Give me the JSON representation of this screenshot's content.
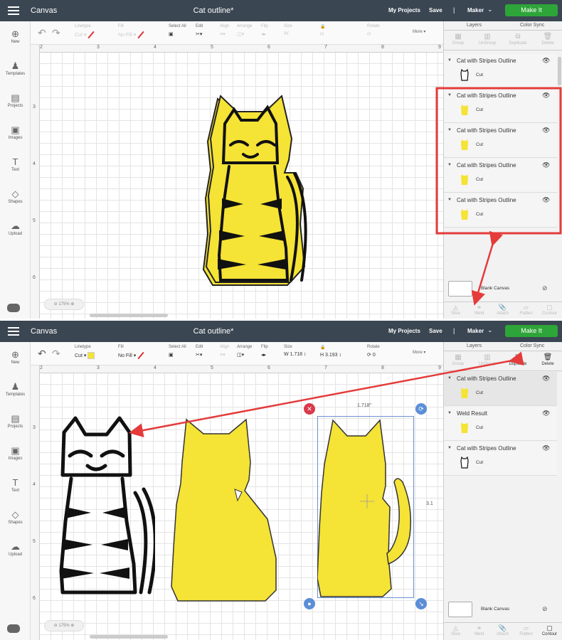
{
  "app": {
    "section": "Canvas",
    "project_title": "Cat outline*",
    "my_projects": "My Projects",
    "save": "Save",
    "separator": "|",
    "machine": "Maker",
    "make_it": "Make It"
  },
  "left_sidebar": [
    "New",
    "Templates",
    "Projects",
    "Images",
    "Text",
    "Shapes",
    "Upload"
  ],
  "toolbar": {
    "linetype_label": "Linetype",
    "linetype_value": "Cut",
    "fill_label": "Fill",
    "fill_value": "No Fill",
    "select_all": "Select All",
    "edit": "Edit",
    "align": "Align",
    "arrange": "Arrange",
    "flip": "Flip",
    "size": "Size",
    "size_w_label": "W",
    "size_h_label": "H",
    "size_w": "1.718",
    "size_h": "3.193",
    "rotate": "Rotate",
    "rotate_value": "0",
    "more": "More"
  },
  "ruler_top": [
    "2",
    "3",
    "4",
    "5",
    "6",
    "7",
    "8",
    "9"
  ],
  "ruler_left": [
    "3",
    "4",
    "5",
    "6"
  ],
  "zoom": "175%",
  "panel": {
    "tabs": [
      "Layers",
      "Color Sync"
    ],
    "layer_tools": [
      "Group",
      "UnGroup",
      "Duplicate",
      "Delete"
    ],
    "bottom_tools": [
      "Slice",
      "Weld",
      "Attach",
      "Flatten",
      "Contour"
    ],
    "blank_canvas": "Blank Canvas",
    "cut": "Cut"
  },
  "shot1": {
    "layers": [
      "Cat with Stripes Outline",
      "Cat with Stripes Outline",
      "Cat with Stripes Outline",
      "Cat with Stripes Outline",
      "Cat with Stripes Outline"
    ]
  },
  "shot2": {
    "layers": [
      "Cat with Stripes Outline",
      "Weld Result",
      "Cat with Stripes Outline"
    ],
    "dim_width": "1.718\"",
    "dim_height": "3.1"
  },
  "colors": {
    "topbar": "#3a4652",
    "make_it": "#2ea538",
    "cat_yellow": "#f5e336",
    "highlight_red": "#e53b3b",
    "selection_blue": "#6a8fd0"
  },
  "icons": {
    "menu": "hamburger-icon",
    "eye": "eye-icon",
    "undo": "undo-icon",
    "redo": "redo-icon"
  }
}
